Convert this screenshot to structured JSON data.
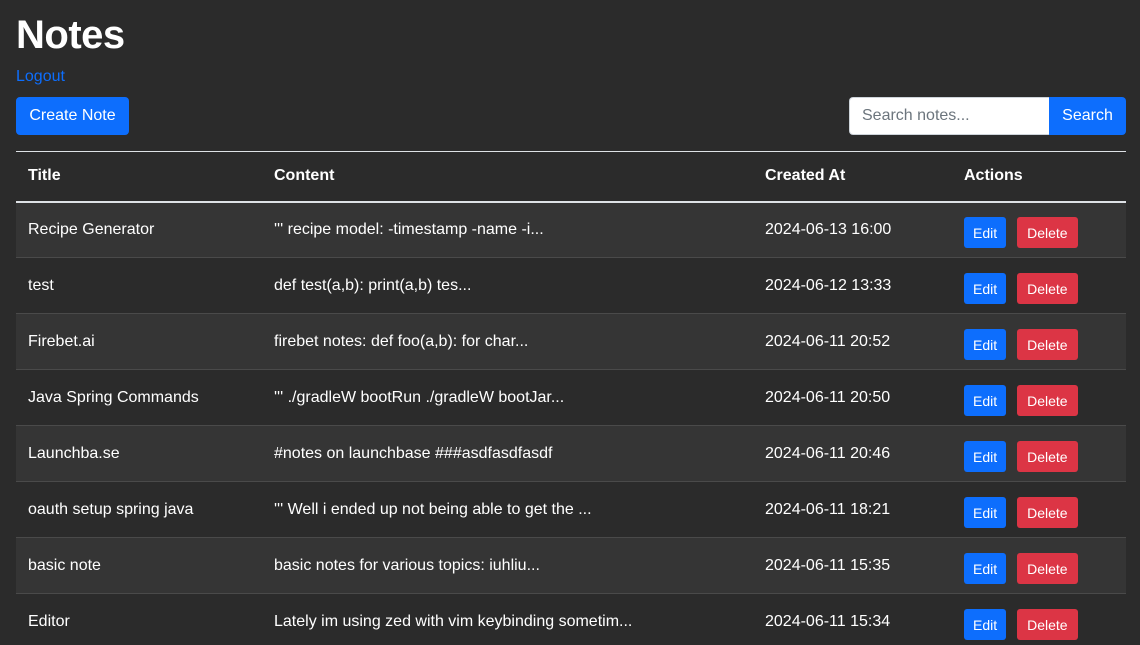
{
  "header": {
    "title": "Notes",
    "logout_label": "Logout",
    "create_label": "Create Note"
  },
  "search": {
    "placeholder": "Search notes...",
    "button_label": "Search"
  },
  "table": {
    "columns": [
      "Title",
      "Content",
      "Created At",
      "Actions"
    ],
    "edit_label": "Edit",
    "delete_label": "Delete",
    "rows": [
      {
        "title": "Recipe Generator",
        "content": "''' recipe model: -timestamp -name -i...",
        "created": "2024-06-13 16:00"
      },
      {
        "title": "test",
        "content": "def test(a,b): print(a,b) tes...",
        "created": "2024-06-12 13:33"
      },
      {
        "title": "Firebet.ai",
        "content": "firebet notes: def foo(a,b): for char...",
        "created": "2024-06-11 20:52"
      },
      {
        "title": "Java Spring Commands",
        "content": "''' ./gradleW bootRun ./gradleW bootJar...",
        "created": "2024-06-11 20:50"
      },
      {
        "title": "Launchba.se",
        "content": "#notes on launchbase ###asdfasdfasdf",
        "created": "2024-06-11 20:46"
      },
      {
        "title": "oauth setup spring java",
        "content": "''' Well i ended up not being able to get the ...",
        "created": "2024-06-11 18:21"
      },
      {
        "title": "basic note",
        "content": "basic notes for various topics: iuhliu...",
        "created": "2024-06-11 15:35"
      },
      {
        "title": "Editor",
        "content": "Lately im using zed with vim keybinding sometim...",
        "created": "2024-06-11 15:34"
      }
    ]
  },
  "colors": {
    "background": "#2b2b2b",
    "accent": "#0d6efd",
    "danger": "#dc3545"
  }
}
